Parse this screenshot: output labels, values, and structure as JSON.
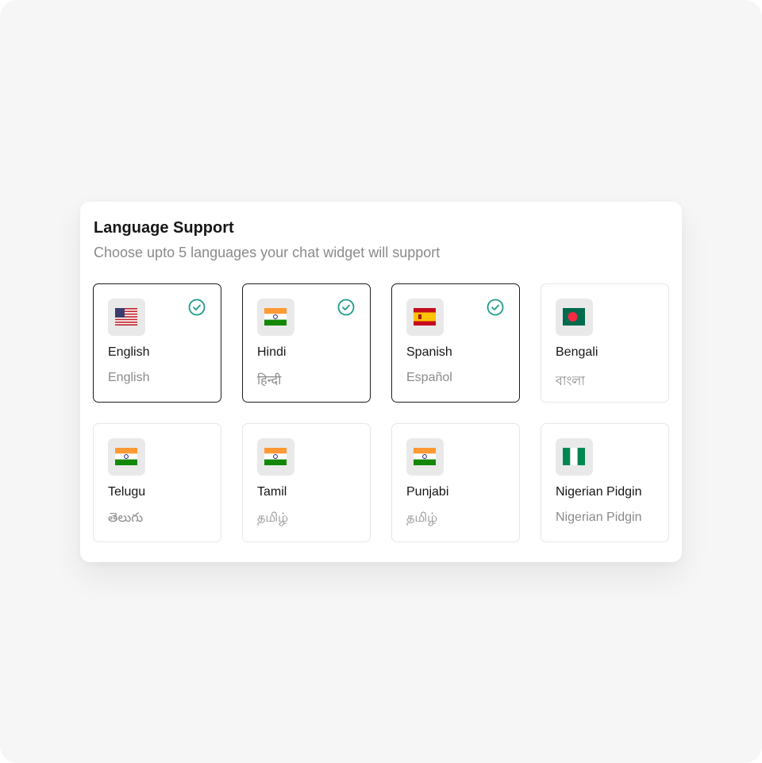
{
  "header": {
    "title": "Language Support",
    "subtitle": "Choose upto 5 languages your chat widget will support"
  },
  "colors": {
    "check_accent": "#1d9a8b",
    "selected_border": "#1c1c1c",
    "card_border": "#e6e6e6"
  },
  "languages": [
    {
      "name": "English",
      "native": "English",
      "flag": "us-flag-icon",
      "selected": true
    },
    {
      "name": "Hindi",
      "native": "हिन्दी",
      "flag": "india-flag-icon",
      "selected": true
    },
    {
      "name": "Spanish",
      "native": "Español",
      "flag": "spain-flag-icon",
      "selected": true
    },
    {
      "name": "Bengali",
      "native": "বাংলা",
      "flag": "bangladesh-flag-icon",
      "selected": false
    },
    {
      "name": "Telugu",
      "native": "తెలుగు",
      "flag": "india-flag-icon",
      "selected": false
    },
    {
      "name": "Tamil",
      "native": "தமிழ்",
      "flag": "india-flag-icon",
      "selected": false
    },
    {
      "name": "Punjabi",
      "native": "தமிழ்",
      "flag": "india-flag-icon",
      "selected": false
    },
    {
      "name": "Nigerian Pidgin",
      "native": "Nigerian Pidgin",
      "flag": "nigeria-flag-icon",
      "selected": false
    }
  ]
}
